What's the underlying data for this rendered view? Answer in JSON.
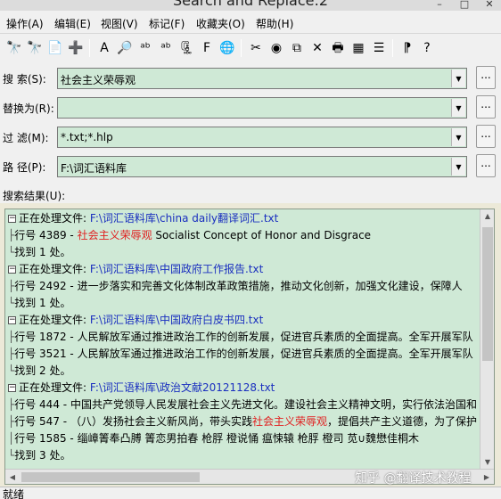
{
  "window": {
    "title": "Search and Replace:2"
  },
  "menu": {
    "items": [
      {
        "label": "操作(A)"
      },
      {
        "label": "编辑(E)"
      },
      {
        "label": "视图(V)"
      },
      {
        "label": "标记(F)"
      },
      {
        "label": "收藏夹(O)"
      },
      {
        "label": "帮助(H)"
      }
    ]
  },
  "toolbar": {
    "icons": [
      "binoculars-icon",
      "binoculars-replace-icon",
      "copy-files-icon",
      "add-files-icon",
      "search-text-icon",
      "search-binary-icon",
      "search-abc-icon",
      "search-replace-abc-icon",
      "zip-search-icon",
      "filter-icon",
      "web-search-icon",
      "scissors-icon",
      "globe-icon",
      "copy-icon",
      "delete-icon",
      "print-icon",
      "notes-icon",
      "list-icon",
      "context-help-icon",
      "help-icon"
    ]
  },
  "form": {
    "search": {
      "label": "搜   索(S):",
      "value": "社会主义荣辱观",
      "browse": "..."
    },
    "replace": {
      "label": "替换为(R):",
      "value": "",
      "browse": "..."
    },
    "filter": {
      "label": "过   滤(M):",
      "value": "*.txt;*.hlp",
      "browse": "..."
    },
    "path": {
      "label": "路   径(P):",
      "value": "F:\\词汇语料库",
      "browse": "..."
    }
  },
  "results": {
    "label": "搜索结果(U):",
    "groups": [
      {
        "processing": "正在处理文件:",
        "file": "F:\\词汇语料库\\china daily翻译词汇.txt",
        "lines": [
          {
            "lineno": "行号 4389 -",
            "pre": "",
            "hit": "社会主义荣辱观",
            "post": " Socialist Concept of Honor and Disgrace"
          }
        ],
        "found": "找到 1 处。"
      },
      {
        "processing": "正在处理文件:",
        "file": "F:\\词汇语料库\\中国政府工作报告.txt",
        "lines": [
          {
            "lineno": "行号 2492 -",
            "pre": "     进一步落实和完善文化体制改革政策措施，推动文化创新，加强文化建设，保障人",
            "hit": "",
            "post": ""
          }
        ],
        "found": "找到 1 处。"
      },
      {
        "processing": "正在处理文件:",
        "file": "F:\\词汇语料库\\中国政府白皮书四.txt",
        "lines": [
          {
            "lineno": "行号 1872 -",
            "pre": " 人民解放军通过推进政治工作的创新发展，促进官兵素质的全面提高。全军开展军队",
            "hit": "",
            "post": ""
          },
          {
            "lineno": "行号 3521 -",
            "pre": " 人民解放军通过推进政治工作的创新发展，促进官兵素质的全面提高。全军开展军队",
            "hit": "",
            "post": ""
          }
        ],
        "found": "找到 2 处。"
      },
      {
        "processing": "正在处理文件:",
        "file": "F:\\词汇语料库\\政治文献20121128.txt",
        "lines": [
          {
            "lineno": "行号 444 -",
            "pre": " 中国共产党领导人民发展社会主义先进文化。建设社会主义精神文明，实行依法治国和",
            "hit": "",
            "post": ""
          },
          {
            "lineno": "行号 547 -",
            "pre": " （八）发扬社会主义新风尚，带头实践",
            "hit": "社会主义荣辱观",
            "post": "，提倡共产主义道德，为了保护"
          },
          {
            "lineno": "行号 1585 -",
            "pre": " 缁嶂箐奉凸膊   箐恋男拍春   枪脬   橙说悀   瘟悚辕   枪脬   橙司   苋∪魏懋佳桐木",
            "hit": "",
            "post": ""
          }
        ],
        "found": "找到 3 处。"
      }
    ]
  },
  "watermark": "知乎 @翻译技术教程",
  "status": {
    "text": "就绪"
  }
}
